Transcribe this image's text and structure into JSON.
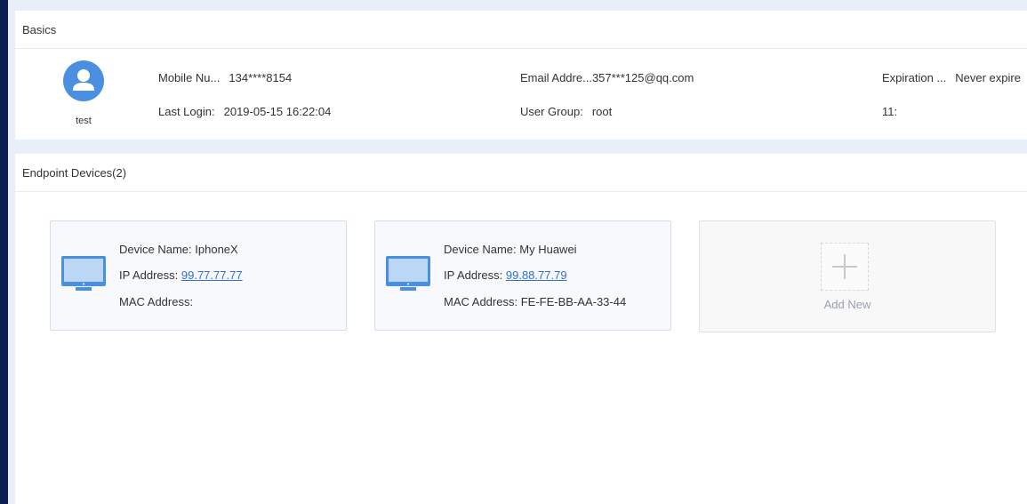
{
  "basics": {
    "title": "Basics",
    "username": "test",
    "mobile_label": "Mobile Nu...",
    "mobile_value": "134****8154",
    "email_label": "Email Addre...",
    "email_value": "357***125@qq.com",
    "expiration_label": "Expiration ...",
    "expiration_value": "Never expire",
    "last_login_label": "Last Login:",
    "last_login_value": "2019-05-15 16:22:04",
    "user_group_label": "User Group:",
    "user_group_value": "root",
    "extra_label": "11:",
    "extra_value": ""
  },
  "devices": {
    "title": "Endpoint Devices(2)",
    "items": [
      {
        "name_label": "Device Name:",
        "name": "IphoneX",
        "ip_label": "IP Address:",
        "ip": "99.77.77.77",
        "mac_label": "MAC Address:",
        "mac": ""
      },
      {
        "name_label": "Device Name:",
        "name": "My Huawei",
        "ip_label": "IP Address:",
        "ip": "99.88.77.79",
        "mac_label": "MAC Address:",
        "mac": "FE-FE-BB-AA-33-44"
      }
    ],
    "add_label": "Add New"
  },
  "colors": {
    "accent": "#4a8fe0",
    "link": "#2f6fd1",
    "background": "#e9eff9"
  }
}
